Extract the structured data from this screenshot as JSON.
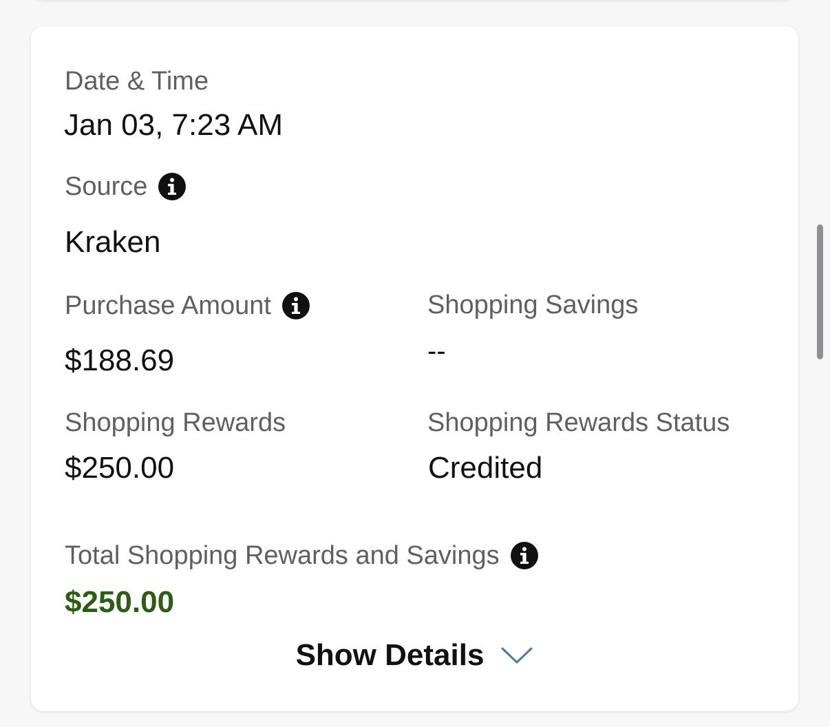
{
  "transaction": {
    "date_time_label": "Date & Time",
    "date_time_value": "Jan 03, 7:23 AM",
    "source_label": "Source",
    "source_value": "Kraken",
    "purchase_amount_label": "Purchase Amount",
    "purchase_amount_value": "$188.69",
    "shopping_savings_label": "Shopping Savings",
    "shopping_savings_value": "--",
    "shopping_rewards_label": "Shopping Rewards",
    "shopping_rewards_value": "$250.00",
    "rewards_status_label": "Shopping Rewards Status",
    "rewards_status_value": "Credited",
    "total_label": "Total Shopping Rewards and Savings",
    "total_value": "$250.00",
    "show_details_label": "Show Details"
  },
  "icons": {
    "info": "info-icon",
    "expand": "chevron-down-icon"
  },
  "colors": {
    "label_gray": "#5f5f63",
    "value_black": "#111111",
    "total_green": "#2f5a18",
    "chevron_blue": "#4a78a0"
  }
}
